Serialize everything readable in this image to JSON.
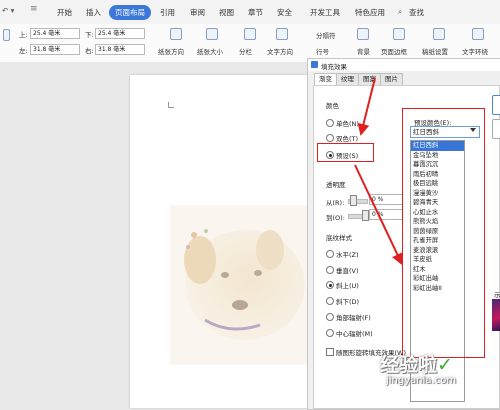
{
  "ribbon": {
    "tabs": [
      "开始",
      "插入",
      "页面布局",
      "引用",
      "审阅",
      "视图",
      "章节",
      "安全",
      "开发工具",
      "特色应用",
      "查找"
    ],
    "active_tab": "页面布局"
  },
  "toolbar": {
    "top_label": "上:",
    "top_value": "25.4 毫米",
    "bottom_label": "下:",
    "bottom_value": "25.4 毫米",
    "left_label": "左:",
    "left_value": "31.8 毫米",
    "right_label": "右:",
    "right_value": "31.8 毫米",
    "paper_direction": "纸张方向",
    "paper_size": "纸张大小",
    "columns": "分栏",
    "text_direction": "文字方向",
    "line_numbers": "行号",
    "separator": "分隔符",
    "background": "背景",
    "page_border": "页面边框",
    "manuscript": "稿纸设置",
    "text_wrap": "文字环绕"
  },
  "dialog": {
    "title": "填充效果",
    "tabs": [
      "渐变",
      "纹理",
      "图案",
      "图片"
    ],
    "colors_group": "颜色",
    "color_options": [
      "单色(N)",
      "双色(T)",
      "预设(S)"
    ],
    "selected_color_option": "预设(S)",
    "preset_label": "预设颜色(E):",
    "preset_value": "红日西斜",
    "transparency_label": "透明度",
    "from_label": "从(R):",
    "from_value": "0 %",
    "to_label": "到(O):",
    "to_value": "0 %",
    "shading_label": "底纹样式",
    "shading_options": [
      "水平(Z)",
      "垂直(V)",
      "斜上(U)",
      "斜下(D)",
      "角部辐射(F)",
      "中心辐射(M)"
    ],
    "selected_shading": "斜上(U)",
    "rotate_checkbox": "随图形旋转填充效果(W)",
    "preset_list": [
      "红日西斜",
      "金乌坠地",
      "暮霭沉沉",
      "雨后初晴",
      "极目远眺",
      "漫漫黄沙",
      "碧海青天",
      "心如止水",
      "熊熊火焰",
      "茵茵绿原",
      "孔雀开屏",
      "麦浪滚滚",
      "羊皮纸",
      "红木",
      "彩虹出岫",
      "彩虹出岫II"
    ],
    "highlighted_item": "红日西斜",
    "side_text": "示"
  },
  "watermark": {
    "line1": "经验啦",
    "check": "✓",
    "line2": "jingyanla.com"
  },
  "colors": {
    "accent": "#3c78d8",
    "highlight": "#e02020"
  }
}
